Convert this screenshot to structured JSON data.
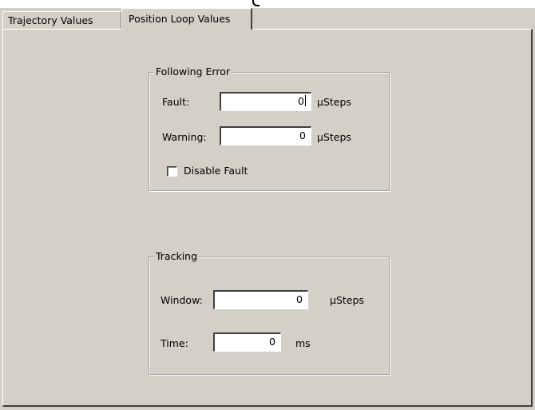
{
  "tabs": [
    {
      "label": "Trajectory Values",
      "active": false
    },
    {
      "label": "Position Loop Values",
      "active": true
    }
  ],
  "following_error": {
    "title": "Following Error",
    "fault": {
      "label": "Fault:",
      "value": "0",
      "unit": "µSteps"
    },
    "warning": {
      "label": "Warning:",
      "value": "0",
      "unit": "µSteps"
    },
    "disable_fault": {
      "label": "Disable Fault",
      "checked": false
    }
  },
  "tracking": {
    "title": "Tracking",
    "window": {
      "label": "Window:",
      "value": "0",
      "unit": "µSteps"
    },
    "time": {
      "label": "Time:",
      "value": "0",
      "unit": "ms"
    }
  },
  "colors": {
    "face": "#d4d0c8",
    "highlight": "#ffffff",
    "shadow": "#808080",
    "dark_shadow": "#404040",
    "field_bg": "#ffffff"
  }
}
